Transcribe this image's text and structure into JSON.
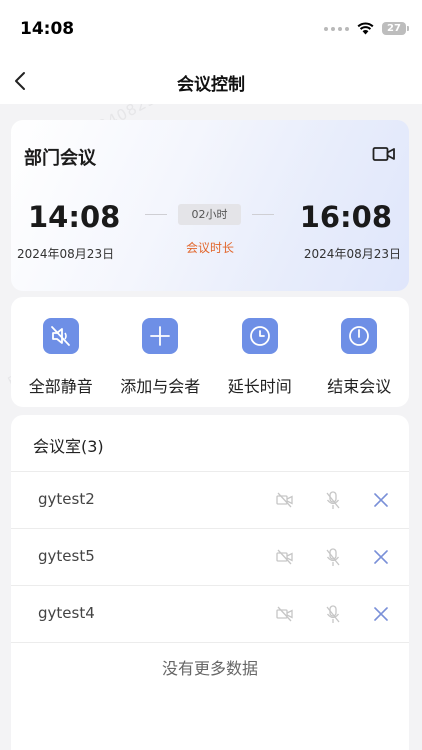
{
  "status_bar": {
    "time": "14:08",
    "battery": "27"
  },
  "nav": {
    "title": "会议控制"
  },
  "meeting": {
    "name": "部门会议",
    "start_time": "14:08",
    "start_date": "2024年08月23日",
    "end_time": "16:08",
    "end_date": "2024年08月23日",
    "duration_value": "02小时",
    "duration_label": "会议时长"
  },
  "actions": [
    {
      "label": "全部静音",
      "icon": "speaker-mute-icon"
    },
    {
      "label": "添加与会者",
      "icon": "plus-icon"
    },
    {
      "label": "延长时间",
      "icon": "clock-icon"
    },
    {
      "label": "结束会议",
      "icon": "power-icon"
    }
  ],
  "room": {
    "header": "会议室(3)",
    "participants": [
      {
        "name": "gytest2"
      },
      {
        "name": "gytest5"
      },
      {
        "name": "gytest4"
      }
    ],
    "no_more": "没有更多数据"
  },
  "watermark": "用户 0220240823",
  "colors": {
    "accent": "#6e8fe6",
    "duration": "#e2672c",
    "remove": "#7a90d8"
  }
}
